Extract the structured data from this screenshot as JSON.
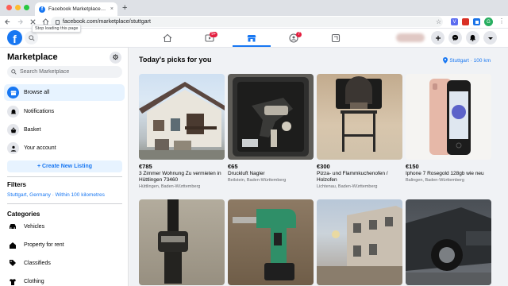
{
  "browser": {
    "tab_title": "Facebook Marketplace | Facebook",
    "tab_close": "×",
    "new_tab": "+",
    "url": "facebook.com/marketplace/stuttgart",
    "tooltip": "Stop loading this page",
    "profile_initial": "G",
    "ext_labels": [
      "V",
      "",
      ""
    ]
  },
  "fbnav": {
    "logo_letter": "f",
    "watch_badge": "9+",
    "groups_badge": "7",
    "active_tab": "marketplace"
  },
  "sidebar": {
    "title": "Marketplace",
    "search_placeholder": "Search Marketplace",
    "items": [
      {
        "label": "Browse all",
        "icon": "storefront-icon"
      },
      {
        "label": "Notifications",
        "icon": "bell-icon"
      },
      {
        "label": "Basket",
        "icon": "basket-icon"
      },
      {
        "label": "Your account",
        "icon": "person-icon"
      }
    ],
    "create_listing": "+ Create New Listing",
    "filters_heading": "Filters",
    "location_filter": "Stuttgart, Germany · Within 100 kilometres",
    "categories_heading": "Categories",
    "categories": [
      {
        "label": "Vehicles",
        "icon": "car-icon"
      },
      {
        "label": "Property for rent",
        "icon": "house-icon"
      },
      {
        "label": "Classifieds",
        "icon": "tag-icon"
      },
      {
        "label": "Clothing",
        "icon": "shirt-icon"
      }
    ]
  },
  "main": {
    "heading": "Today's picks for you",
    "location": "Stuttgart · 100 km",
    "listings": [
      {
        "price": "€785",
        "title": "3 Zimmer Wohnung Zu vermieten in Hüttlingen 73460",
        "location": "Hüttlingen, Baden-Württemberg"
      },
      {
        "price": "€65",
        "title": "Druckluft Nagler",
        "location": "Beilstein, Baden-Württemberg"
      },
      {
        "price": "€300",
        "title": "Pizza- und Flammkuchenofen / Holzofen",
        "location": "Lichtenau, Baden-Württemberg"
      },
      {
        "price": "€150",
        "title": "Iphone 7 Rosegold 128gb wie neu",
        "location": "Balingen, Baden-Württemberg"
      },
      {
        "price": "",
        "title": "",
        "location": ""
      },
      {
        "price": "",
        "title": "",
        "location": ""
      },
      {
        "price": "",
        "title": "",
        "location": ""
      },
      {
        "price": "",
        "title": "",
        "location": ""
      }
    ]
  },
  "colors": {
    "brand": "#1877f2",
    "badge": "#e41e3f",
    "sidebar_active": "#e7f3ff",
    "feed_bg": "#f0f2f5"
  }
}
